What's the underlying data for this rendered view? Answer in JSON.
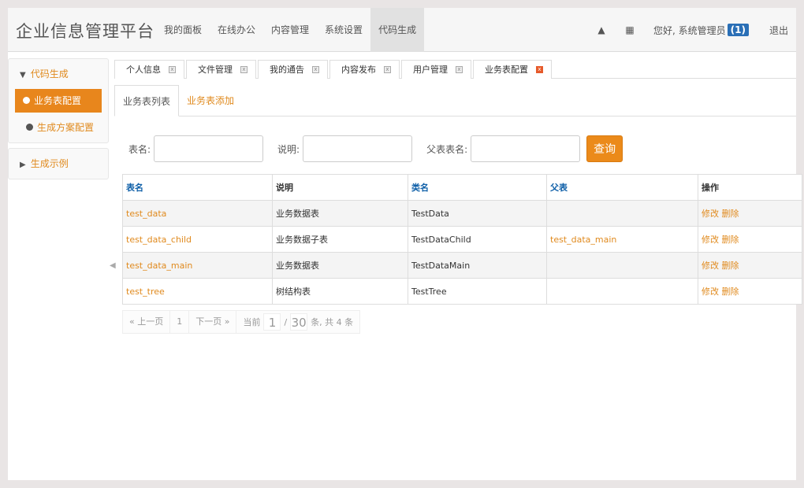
{
  "brand": "企业信息管理平台",
  "nav": [
    "我的面板",
    "在线办公",
    "内容管理",
    "系统设置",
    "代码生成"
  ],
  "nav_active": 4,
  "top_right": {
    "home_icon": "home-icon",
    "apps_icon": "grid-icon",
    "greeting": "您好, 系统管理员",
    "badge": "(1)",
    "logout": "退出"
  },
  "sidebar": {
    "group1": "代码生成",
    "items": [
      "业务表配置",
      "生成方案配置"
    ],
    "group2": "生成示例"
  },
  "tabs": [
    "个人信息",
    "文件管理",
    "我的通告",
    "内容发布",
    "用户管理",
    "业务表配置"
  ],
  "subtabs": [
    "业务表列表",
    "业务表添加"
  ],
  "search": {
    "label1": "表名:",
    "label2": "说明:",
    "label3": "父表表名:",
    "button": "查询"
  },
  "table": {
    "headers": [
      "表名",
      "说明",
      "类名",
      "父表",
      "操作"
    ],
    "rows": [
      [
        "test_data",
        "业务数据表",
        "TestData",
        "",
        "修改",
        "删除"
      ],
      [
        "test_data_child",
        "业务数据子表",
        "TestDataChild",
        "test_data_main",
        "修改",
        "删除"
      ],
      [
        "test_data_main",
        "业务数据表",
        "TestDataMain",
        "",
        "修改",
        "删除"
      ],
      [
        "test_tree",
        "树结构表",
        "TestTree",
        "",
        "修改",
        "删除"
      ]
    ]
  },
  "pager": {
    "prev": "« 上一页",
    "page": "1",
    "next": "下一页 »",
    "current_label": "当前",
    "current": "1",
    "sep": "/",
    "size": "30",
    "tail": "条, 共 4 条"
  }
}
